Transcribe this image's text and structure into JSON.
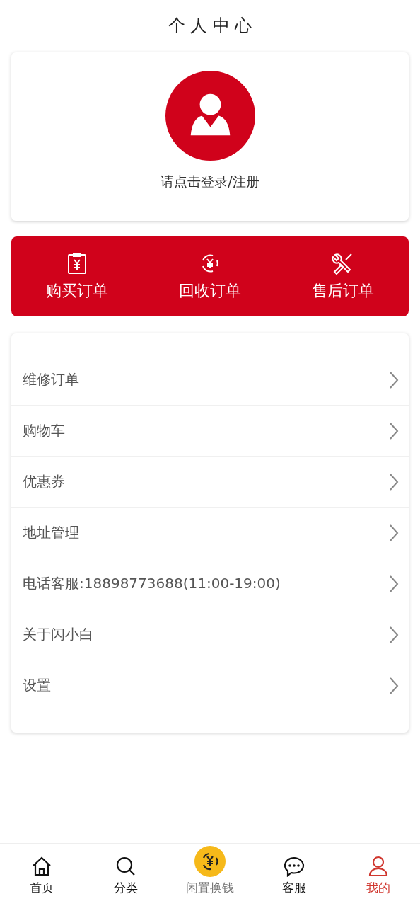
{
  "header": {
    "title": "个 人 中 心"
  },
  "profile": {
    "login_prompt": "请点击登录/注册"
  },
  "orders": [
    {
      "kind": "buy",
      "label": "购买订单"
    },
    {
      "kind": "recycle",
      "label": "回收订单"
    },
    {
      "kind": "service",
      "label": "售后订单"
    }
  ],
  "menu": [
    {
      "label": "维修订单"
    },
    {
      "label": "购物车"
    },
    {
      "label": "优惠券"
    },
    {
      "label": "地址管理"
    },
    {
      "label": "电话客服:18898773688(11:00-19:00)"
    },
    {
      "label": "关于闪小白"
    },
    {
      "label": "设置"
    }
  ],
  "tab_bar": [
    {
      "kind": "home",
      "label": "首页",
      "selected": false
    },
    {
      "kind": "search",
      "label": "分类",
      "selected": false
    },
    {
      "kind": "center",
      "label": "闲置换钱",
      "selected": false
    },
    {
      "kind": "chat",
      "label": "客服",
      "selected": false
    },
    {
      "kind": "user",
      "label": "我的",
      "selected": true
    }
  ]
}
